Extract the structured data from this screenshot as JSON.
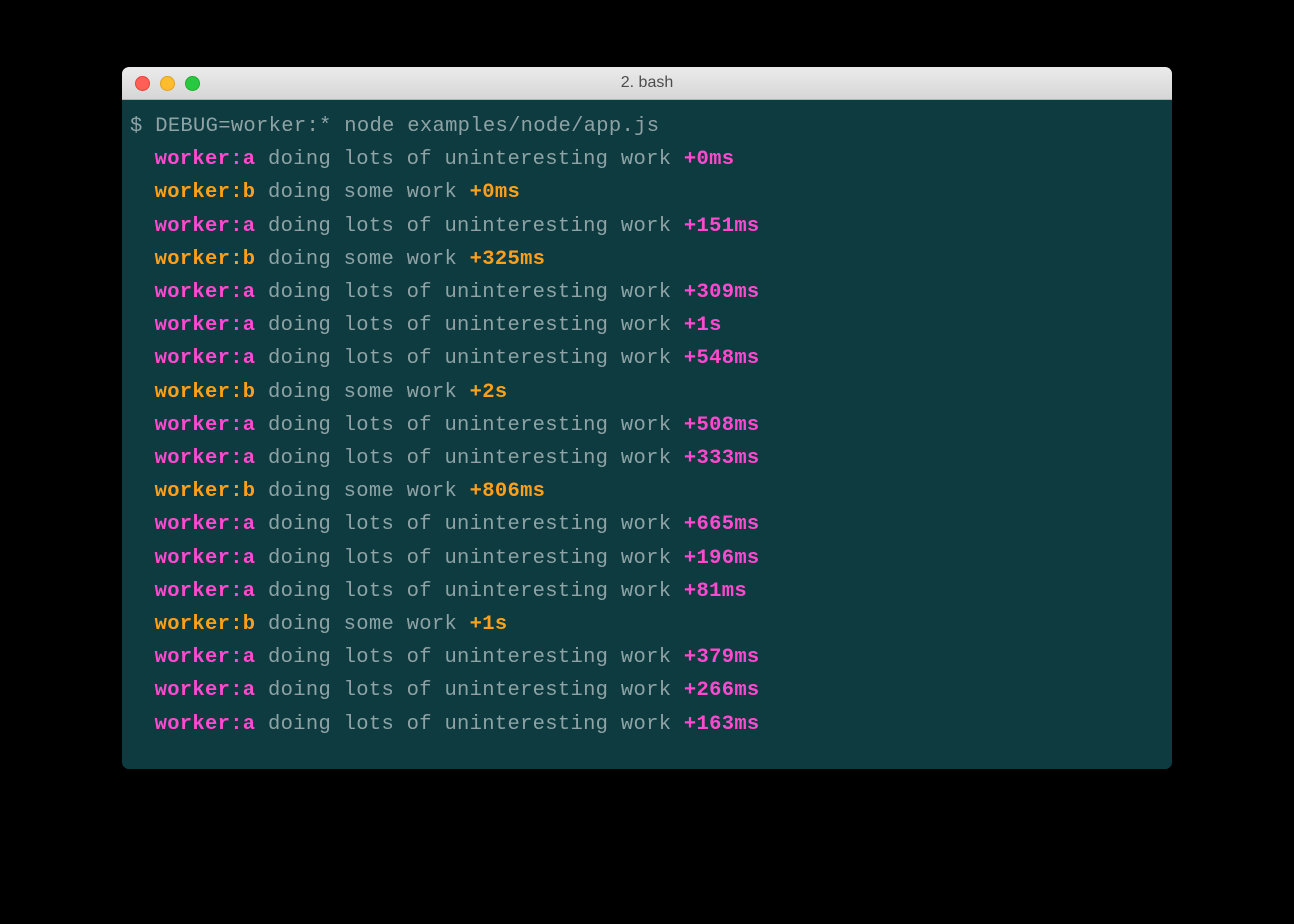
{
  "window": {
    "title": "2. bash"
  },
  "terminal": {
    "prompt": "$ ",
    "command": "DEBUG=worker:* node examples/node/app.js",
    "colors": {
      "a": "#ff49d0",
      "b": "#ff9f1a",
      "background": "#0d3b3f",
      "text": "#8fa3a6"
    },
    "lines": [
      {
        "ns": "worker:a",
        "kind": "a",
        "msg": "doing lots of uninteresting work",
        "ts": "+0ms"
      },
      {
        "ns": "worker:b",
        "kind": "b",
        "msg": "doing some work",
        "ts": "+0ms"
      },
      {
        "ns": "worker:a",
        "kind": "a",
        "msg": "doing lots of uninteresting work",
        "ts": "+151ms"
      },
      {
        "ns": "worker:b",
        "kind": "b",
        "msg": "doing some work",
        "ts": "+325ms"
      },
      {
        "ns": "worker:a",
        "kind": "a",
        "msg": "doing lots of uninteresting work",
        "ts": "+309ms"
      },
      {
        "ns": "worker:a",
        "kind": "a",
        "msg": "doing lots of uninteresting work",
        "ts": "+1s"
      },
      {
        "ns": "worker:a",
        "kind": "a",
        "msg": "doing lots of uninteresting work",
        "ts": "+548ms"
      },
      {
        "ns": "worker:b",
        "kind": "b",
        "msg": "doing some work",
        "ts": "+2s"
      },
      {
        "ns": "worker:a",
        "kind": "a",
        "msg": "doing lots of uninteresting work",
        "ts": "+508ms"
      },
      {
        "ns": "worker:a",
        "kind": "a",
        "msg": "doing lots of uninteresting work",
        "ts": "+333ms"
      },
      {
        "ns": "worker:b",
        "kind": "b",
        "msg": "doing some work",
        "ts": "+806ms"
      },
      {
        "ns": "worker:a",
        "kind": "a",
        "msg": "doing lots of uninteresting work",
        "ts": "+665ms"
      },
      {
        "ns": "worker:a",
        "kind": "a",
        "msg": "doing lots of uninteresting work",
        "ts": "+196ms"
      },
      {
        "ns": "worker:a",
        "kind": "a",
        "msg": "doing lots of uninteresting work",
        "ts": "+81ms"
      },
      {
        "ns": "worker:b",
        "kind": "b",
        "msg": "doing some work",
        "ts": "+1s"
      },
      {
        "ns": "worker:a",
        "kind": "a",
        "msg": "doing lots of uninteresting work",
        "ts": "+379ms"
      },
      {
        "ns": "worker:a",
        "kind": "a",
        "msg": "doing lots of uninteresting work",
        "ts": "+266ms"
      },
      {
        "ns": "worker:a",
        "kind": "a",
        "msg": "doing lots of uninteresting work",
        "ts": "+163ms"
      }
    ]
  }
}
